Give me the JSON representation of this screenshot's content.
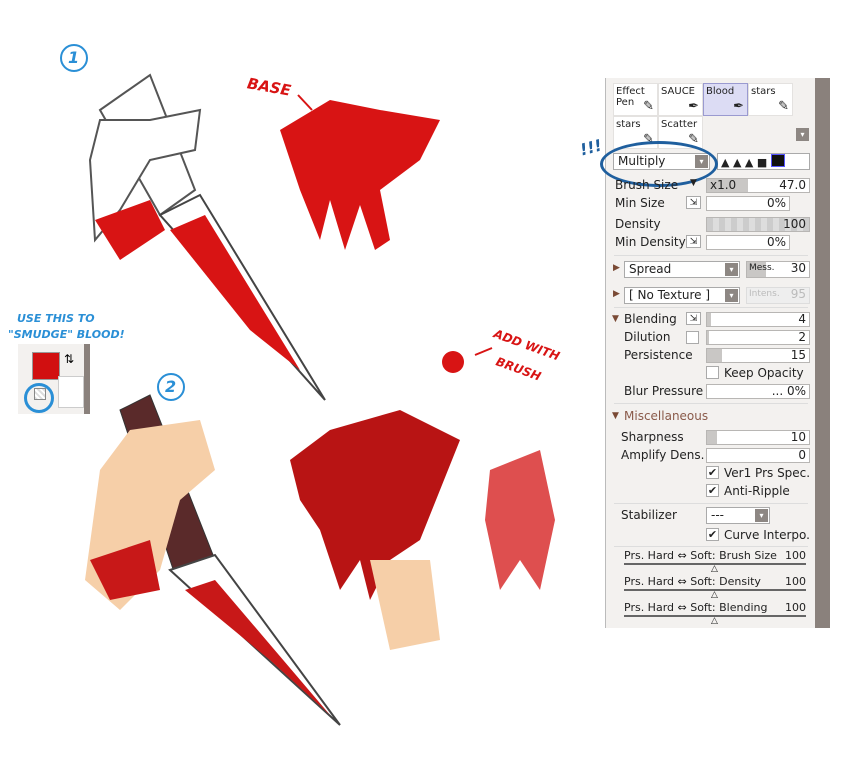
{
  "annotations": {
    "step1": "1",
    "step2": "2",
    "base": "BASE",
    "exclaim": "!!!",
    "smudge_line1": "USE THIS TO",
    "smudge_line2": "\"SMUDGE\" BLOOD!",
    "add_line1": "ADD WITH",
    "add_line2": "BRUSH"
  },
  "colors": {
    "blood": "#d81414",
    "annotation_blue": "#2a8fd6",
    "ellipse_blue": "#1f5f9e",
    "primary_color": "#d10f10"
  },
  "brushes": [
    {
      "label": "Effect Pen",
      "icon": "pencil-icon"
    },
    {
      "label": "SAUCE",
      "icon": "pen-icon"
    },
    {
      "label": "Blood",
      "icon": "pen-icon",
      "selected": true
    },
    {
      "label": "stars",
      "icon": "pencil-icon"
    },
    {
      "label": "stars",
      "icon": "pencil-icon"
    },
    {
      "label": "Scatter",
      "icon": "pencil-icon"
    }
  ],
  "blend_mode": "Multiply",
  "brush_size": {
    "label": "Brush Size",
    "multiplier": "x1.0",
    "value": "47.0"
  },
  "min_size": {
    "label": "Min Size",
    "value": "0%"
  },
  "density": {
    "label": "Density",
    "value": "100"
  },
  "min_density": {
    "label": "Min Density",
    "value": "0%"
  },
  "spread": {
    "label": "Spread",
    "param": "Mess.",
    "value": "30"
  },
  "texture": {
    "label": "[ No Texture ]",
    "param": "Intens.",
    "value": "95"
  },
  "blending": {
    "label": "Blending",
    "value": "4",
    "percent": 4
  },
  "dilution": {
    "label": "Dilution",
    "value": "2",
    "percent": 2
  },
  "persistence": {
    "label": "Persistence",
    "value": "15",
    "percent": 15
  },
  "keep_opacity": {
    "label": "Keep Opacity",
    "checked": false
  },
  "blur_pressure": {
    "label": "Blur Pressure",
    "value": "... 0%"
  },
  "misc": {
    "label": "Miscellaneous"
  },
  "sharpness": {
    "label": "Sharpness",
    "value": "10",
    "percent": 10
  },
  "amplify": {
    "label": "Amplify Dens.",
    "value": "0"
  },
  "ver1": {
    "label": "Ver1 Prs Spec.",
    "checked": true
  },
  "anti_ripple": {
    "label": "Anti-Ripple",
    "checked": true
  },
  "stabilizer": {
    "label": "Stabilizer",
    "value": "---"
  },
  "curve": {
    "label": "Curve Interpo.",
    "checked": true
  },
  "prs": [
    {
      "label": "Prs. Hard ⇔ Soft: Brush Size",
      "value": "100"
    },
    {
      "label": "Prs. Hard ⇔ Soft: Density",
      "value": "100"
    },
    {
      "label": "Prs. Hard ⇔ Soft: Blending",
      "value": "100"
    }
  ],
  "check_mark": "✔"
}
